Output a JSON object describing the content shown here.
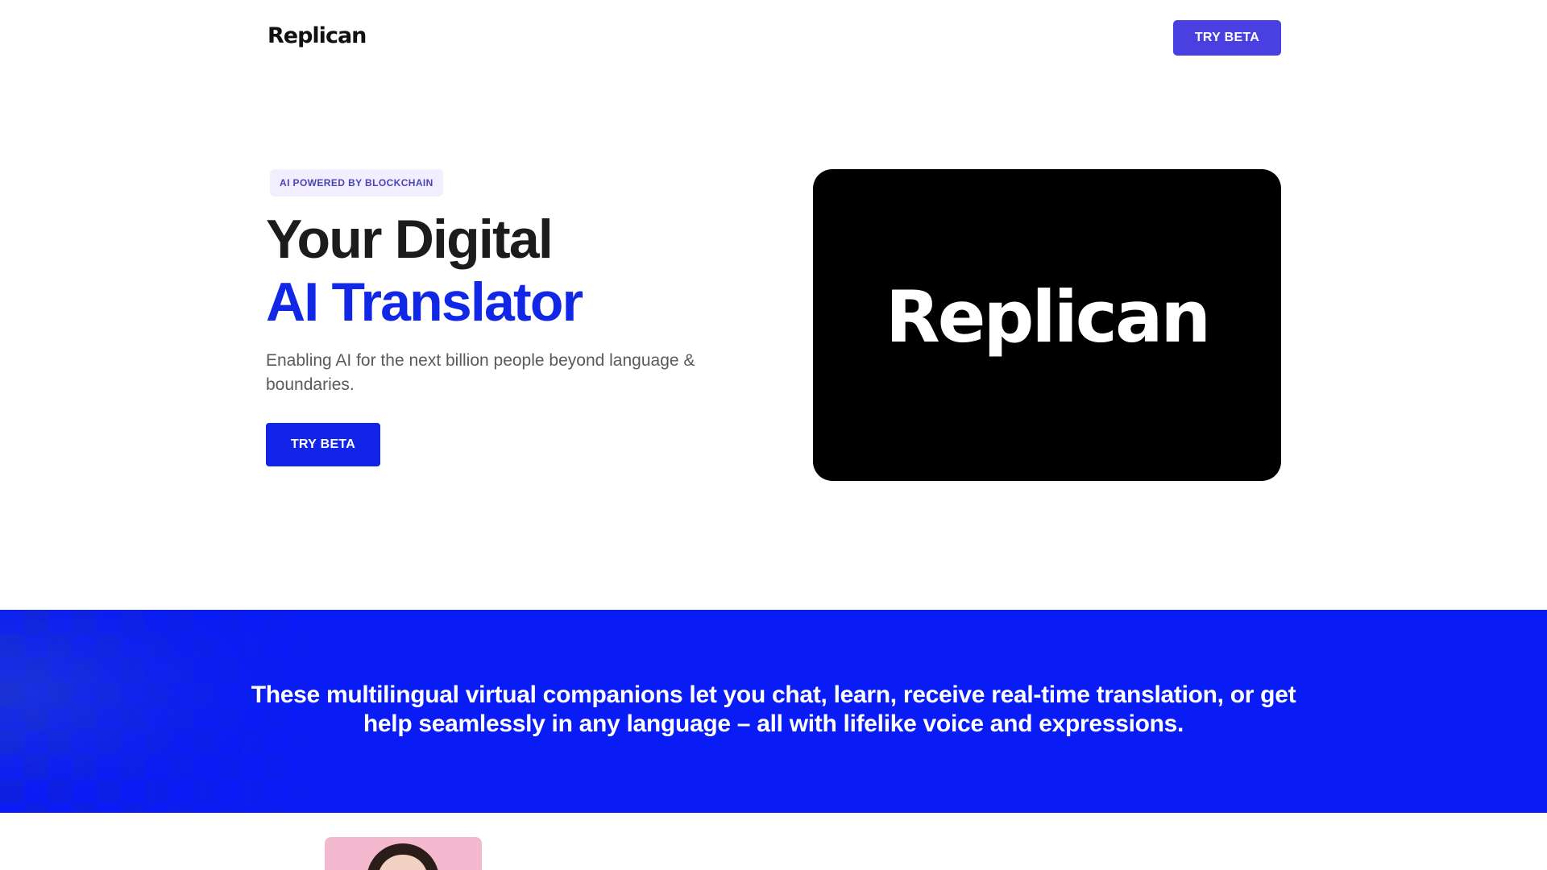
{
  "header": {
    "logo": "Replican",
    "cta_label": "TRY BETA"
  },
  "hero": {
    "badge": "AI POWERED BY BLOCKCHAIN",
    "headline_line1": "Your Digital",
    "headline_line2": "AI Translator",
    "subtext": "Enabling AI for the next billion people beyond language & boundaries.",
    "cta_label": "TRY BETA",
    "media_logo": "Replican"
  },
  "band": {
    "text": "These multilingual virtual companions let you chat, learn, receive real-time translation, or get help seamlessly in any language – all with lifelike voice and expressions."
  },
  "colors": {
    "accent_blue": "#1224e8",
    "header_button": "#4a3fe0",
    "band_blue": "#0a1cf5"
  }
}
